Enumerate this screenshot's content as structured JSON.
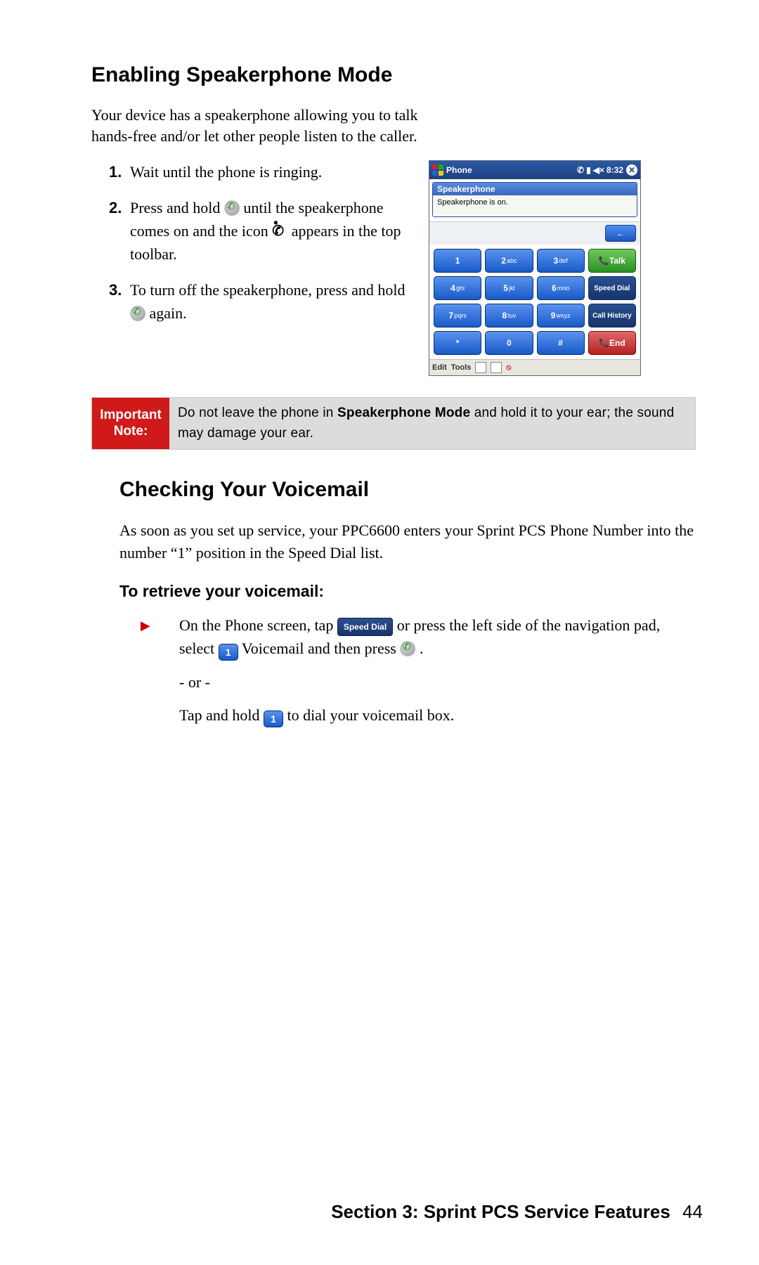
{
  "section1": {
    "heading": "Enabling Speakerphone Mode",
    "intro": "Your device has a speakerphone allowing you to talk hands-free and/or let other people listen to the caller.",
    "step1_num": "1.",
    "step1_text": "Wait  until  the phone is ringing.",
    "step2_num": "2.",
    "step2_a": "Press and hold ",
    "step2_b": " until the speakerphone comes on and the icon ",
    "step2_c": " appears in the top toolbar.",
    "step3_num": "3.",
    "step3_a": "To turn off the speakerphone, press  and hold ",
    "step3_b": " again."
  },
  "device": {
    "title": "Phone",
    "time": "8:32",
    "popup_title": "Speakerphone",
    "popup_body": "Speakerphone is on.",
    "keys": {
      "k1": "1",
      "k2": "2",
      "k2s": "abc",
      "k3": "3",
      "k3s": "def",
      "k4": "4",
      "k4s": "ghi",
      "k5": "5",
      "k5s": "jkl",
      "k6": "6",
      "k6s": "mno",
      "k7": "7",
      "k7s": "pqrs",
      "k8": "8",
      "k8s": "tuv",
      "k9": "9",
      "k9s": "wxyz",
      "star": "*",
      "k0": "0",
      "hash": "#"
    },
    "actions": {
      "talk": "Talk",
      "speed": "Speed Dial",
      "history": "Call History",
      "end": "End"
    },
    "bottom": {
      "edit": "Edit",
      "tools": "Tools"
    }
  },
  "note": {
    "label": "Important Note:",
    "text_a": "Do not leave the phone in ",
    "text_bold": "Speakerphone Mode",
    "text_b": " and hold it to your ear; the sound may damage your ear."
  },
  "section2": {
    "heading": "Checking Your Voicemail",
    "intro": "As soon as you set up service, your PPC6600 enters your Sprint PCS Phone Number into the number “1” position in the Speed Dial list.",
    "subheading": "To retrieve your voicemail:",
    "b1_a": "On the Phone screen, tap ",
    "b1_b": " or press the left side of the navigation pad, select ",
    "b1_c": " Voicemail and then press ",
    "b1_d": " .",
    "or": "- or -",
    "b2_a": "Tap and hold ",
    "b2_b": "  to dial your voicemail box.",
    "speed_dial_label": "Speed Dial",
    "one_key_label": "1"
  },
  "footer": {
    "section": "Section 3: Sprint PCS Service Features",
    "page": "44"
  }
}
